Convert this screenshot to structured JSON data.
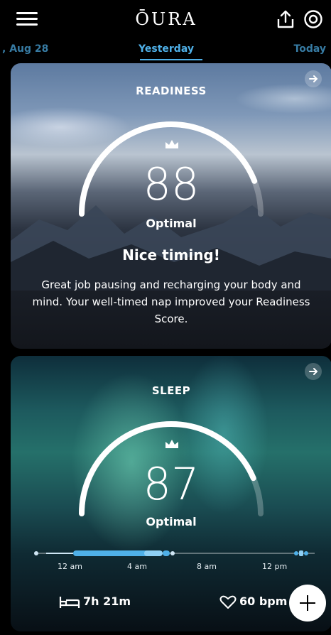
{
  "app": {
    "logo": "ŌURA"
  },
  "tabs": {
    "previous": ", Aug 28",
    "current": "Yesterday",
    "next": "Today"
  },
  "readiness": {
    "title": "READINESS",
    "score": "88",
    "score_value": 88,
    "status": "Optimal",
    "headline": "Nice timing!",
    "description": "Great job pausing and recharging your body and mind. Your well-timed nap improved your Readiness Score."
  },
  "sleep": {
    "title": "SLEEP",
    "score": "87",
    "score_value": 87,
    "status": "Optimal",
    "timeline_labels": [
      "12 am",
      "4 am",
      "8 am",
      "12 pm"
    ],
    "duration": "7h 21m",
    "heart_rate": "60 bpm"
  },
  "colors": {
    "accent": "#4fb0e8",
    "gauge": "#ffffff",
    "timeline": "#4fb0e8"
  },
  "icons": [
    "menu-icon",
    "share-icon",
    "settings-icon",
    "arrow-right-icon",
    "crown-icon",
    "bed-icon",
    "heart-icon",
    "plus-icon"
  ]
}
